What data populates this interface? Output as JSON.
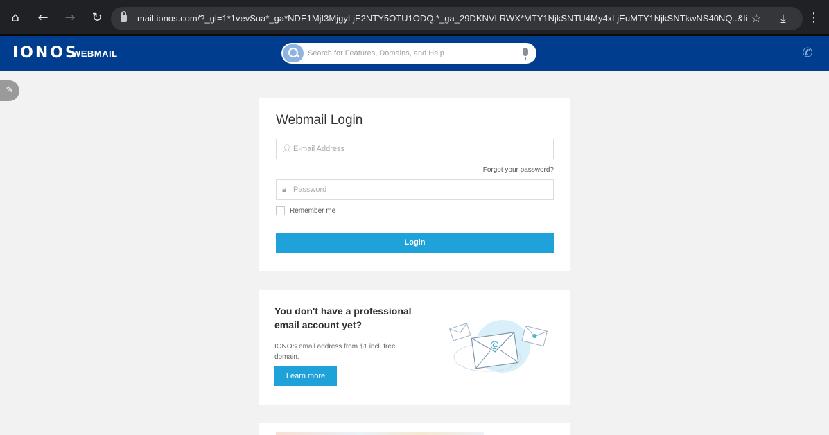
{
  "browser": {
    "url": "mail.ionos.com/?_gl=1*1vevSua*_ga*NDE1MjI3MjgyLjE2NTY5OTU1ODQ.*_ga_29DKNVLRWX*MTY1NjkSNTU4My4xLjEuMTY1NjkSNTkwNS40NQ..&lin",
    "icons": [
      "home-icon",
      "back-icon",
      "forward-icon",
      "reload-icon",
      "lock-icon",
      "star-icon",
      "download-icon",
      "menu-icon"
    ]
  },
  "header": {
    "logo": "IONOS",
    "product": "WEBMAIL",
    "search_placeholder": "Search for Features, Domains, and Help",
    "brand_color": "#003d8f"
  },
  "login": {
    "title": "Webmail Login",
    "email_placeholder": "E-mail Address",
    "forgot_label": "Forgot your password?",
    "password_placeholder": "Password",
    "remember_label": "Remember me",
    "remember_checked": false,
    "login_label": "Login",
    "accent_color": "#1fa2d9"
  },
  "promo": {
    "title": "You don't have a professional email account yet?",
    "text": "IONOS email address from $1 incl. free domain.",
    "button_label": "Learn more"
  }
}
